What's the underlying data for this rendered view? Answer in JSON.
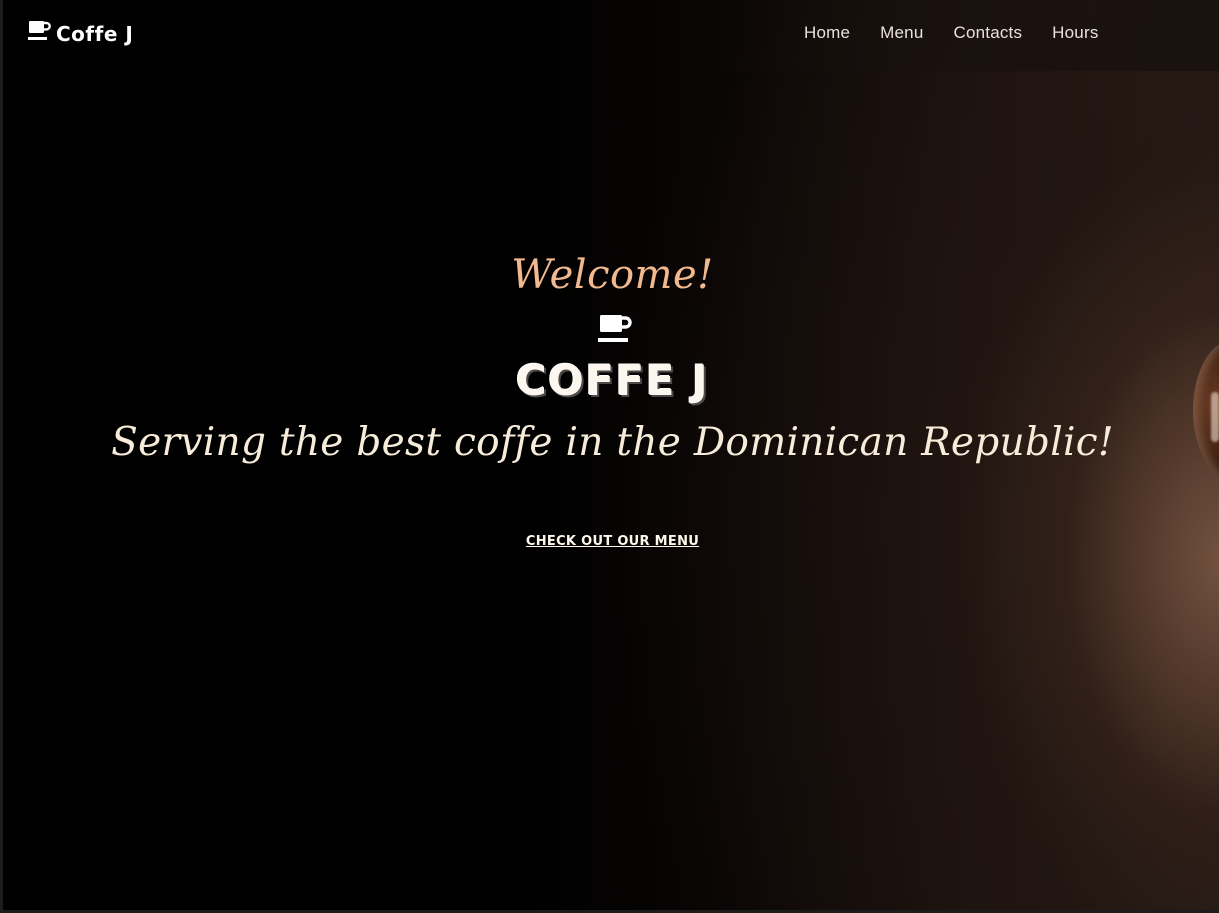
{
  "brand": {
    "name": "Coffe J",
    "icon": "coffee-cup-icon"
  },
  "nav": {
    "items": [
      {
        "label": "Home"
      },
      {
        "label": "Menu"
      },
      {
        "label": "Contacts"
      },
      {
        "label": "Hours"
      }
    ]
  },
  "hero": {
    "welcome": "Welcome!",
    "icon": "coffee-cup-icon",
    "title": "COFFE J",
    "tagline": "Serving the best coffe in the Dominican Republic!",
    "cta_label": "CHECK OUT OUR MENU"
  },
  "colors": {
    "background": "#000000",
    "welcome_accent": "#f0b98f",
    "text": "#fbf6ee"
  }
}
